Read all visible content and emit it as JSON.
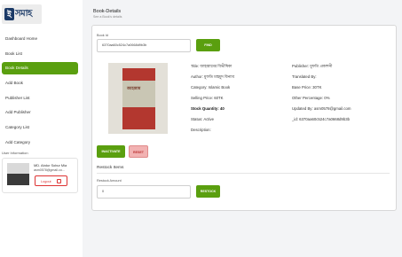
{
  "logo": {
    "mark": "ই",
    "text": "সমাহ"
  },
  "sidebar": {
    "items": [
      {
        "label": "Dashboard Home"
      },
      {
        "label": "Book List"
      },
      {
        "label": "Book Details"
      },
      {
        "label": "Add Book"
      },
      {
        "label": "Publisher List"
      },
      {
        "label": "Add Publisher"
      },
      {
        "label": "Category List"
      },
      {
        "label": "Add Category"
      }
    ],
    "active_index": 2
  },
  "user": {
    "section_title": "User Information",
    "name": "MD. Abdur Sobur Mia",
    "email": "asm0578@gmail.co...",
    "logout_label": "Logout"
  },
  "header": {
    "title": "Book-Details",
    "subtitle": "See a Book's details"
  },
  "search": {
    "label": "Book Id",
    "value": "6370aa60c524c7a0668d9b3b",
    "button_label": "FIND"
  },
  "book": {
    "cover_title": "জাহান্নাম",
    "left": [
      {
        "text": "Title: জাহান্নামের বিভীষিকা",
        "bold": false
      },
      {
        "text": "Author: মুফতি মাহমুদ বিন্যাব",
        "bold": false
      },
      {
        "text": "Category: Islamic Book",
        "bold": false
      },
      {
        "text": "Selling Price: 60TK",
        "bold": false
      },
      {
        "text": "Stock Quantity: 40",
        "bold": true
      },
      {
        "text": "Status: Active",
        "bold": false
      },
      {
        "text": "Description:",
        "bold": false
      }
    ],
    "right": [
      {
        "text": "Publisher: মুফতি প্রকাশনী"
      },
      {
        "text": "Translated By:"
      },
      {
        "text": "Base Price: 30TK"
      },
      {
        "text": "Other Percentage: 0%"
      },
      {
        "text": "Updated By: asm0578@gmail.com"
      },
      {
        "text": "_id: 6370aa60c524c7a0668d9b3b"
      }
    ]
  },
  "actions": {
    "inactivate_label": "INACTIVATE",
    "reset_label": "RESET"
  },
  "restock": {
    "title": "Restock Items",
    "amount_label": "Restock Amount",
    "amount_value": "0",
    "button_label": "RESTOCK"
  }
}
